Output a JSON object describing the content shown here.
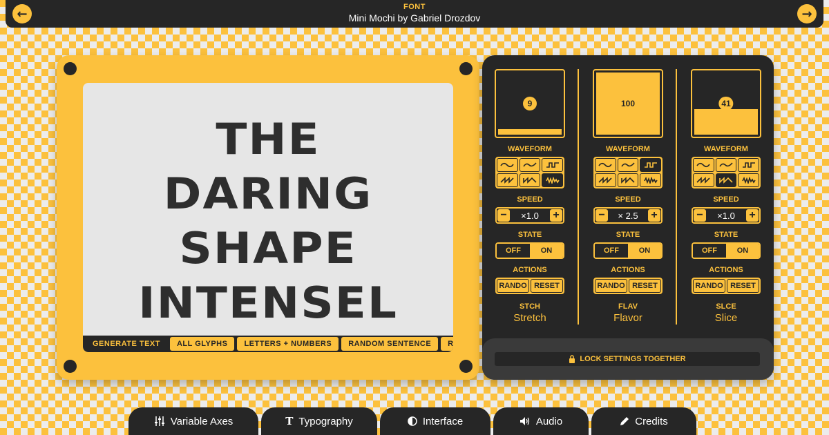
{
  "header": {
    "label": "FONT",
    "title": "Mini Mochi by Gabriel Drozdov",
    "prev_icon": "←",
    "next_icon": "→"
  },
  "preview": {
    "lines": [
      "THE",
      "DARING",
      "SHAPE",
      "INTENSEL"
    ],
    "tabs": [
      {
        "label": "GENERATE TEXT",
        "active": true
      },
      {
        "label": "ALL GLYPHS",
        "active": false
      },
      {
        "label": "LETTERS + NUMBERS",
        "active": false
      },
      {
        "label": "RANDOM SENTENCE",
        "active": false
      },
      {
        "label": "RAN",
        "active": false
      }
    ]
  },
  "controls": {
    "waveform_label": "WAVEFORM",
    "speed_label": "SPEED",
    "state_label": "STATE",
    "actions_label": "ACTIONS",
    "off": "OFF",
    "on": "ON",
    "rando": "RANDO",
    "reset": "RESET",
    "minus": "−",
    "plus": "+",
    "axes": [
      {
        "value": "9",
        "fill": 0.09,
        "speed": "×1.0",
        "tag": "STCH",
        "name": "Stretch",
        "selected_wave": 5
      },
      {
        "value": "100",
        "fill": 1.0,
        "speed": "× 2.5",
        "tag": "FLAV",
        "name": "Flavor",
        "selected_wave": 2
      },
      {
        "value": "41",
        "fill": 0.41,
        "speed": "×1.0",
        "tag": "SLCE",
        "name": "Slice",
        "selected_wave": 4
      }
    ],
    "waveforms": [
      "sine",
      "sine-alt",
      "square",
      "sawtooth",
      "reverse-saw",
      "noise"
    ]
  },
  "lock": {
    "label": "LOCK SETTINGS TOGETHER",
    "icon": "lock-icon"
  },
  "dock": [
    {
      "label": "Variable Axes",
      "icon": "sliders-icon"
    },
    {
      "label": "Typography",
      "icon": "type-icon"
    },
    {
      "label": "Interface",
      "icon": "contrast-icon"
    },
    {
      "label": "Audio",
      "icon": "speaker-icon"
    },
    {
      "label": "Credits",
      "icon": "pencil-icon"
    }
  ],
  "colors": {
    "accent": "#fcc13d",
    "dark": "#262626",
    "screen": "#e6e6e6"
  }
}
